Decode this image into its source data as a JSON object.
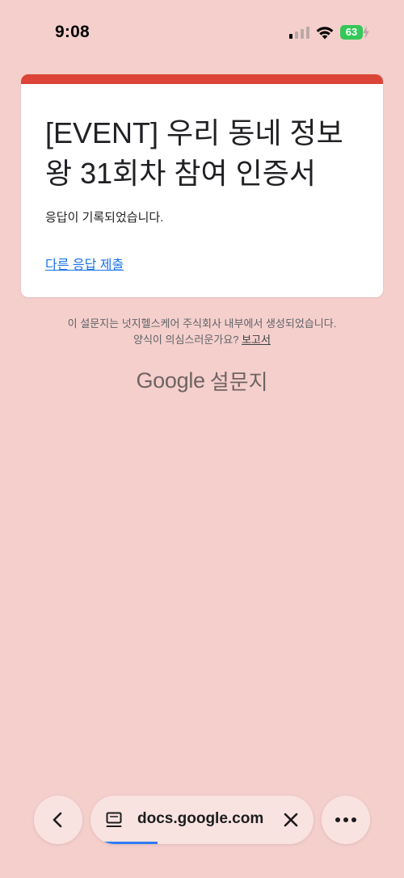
{
  "status_bar": {
    "time": "9:08",
    "battery_level": "63",
    "signal_bars_active": 1,
    "signal_bars_total": 4
  },
  "form": {
    "accent_color": "#db4437",
    "title": "[EVENT] 우리 동네 정보왕 31회차 참여 인증서",
    "confirmation_message": "응답이 기록되었습니다.",
    "submit_another_link": "다른 응답 제출"
  },
  "footer": {
    "created_notice": "이 설문지는 넛지헬스케어 주식회사 내부에서 생성되었습니다.",
    "suspicious_prompt": "양식이 의심스러운가요?",
    "report_link": "보고서",
    "brand_google": "Google",
    "brand_forms": "설문지"
  },
  "browser": {
    "url": "docs.google.com",
    "back_icon": "chevron-left-icon",
    "tab_icon": "tab-icon",
    "close_icon": "close-icon",
    "more_icon": "more-horizontal-icon",
    "load_progress": 0.3
  }
}
